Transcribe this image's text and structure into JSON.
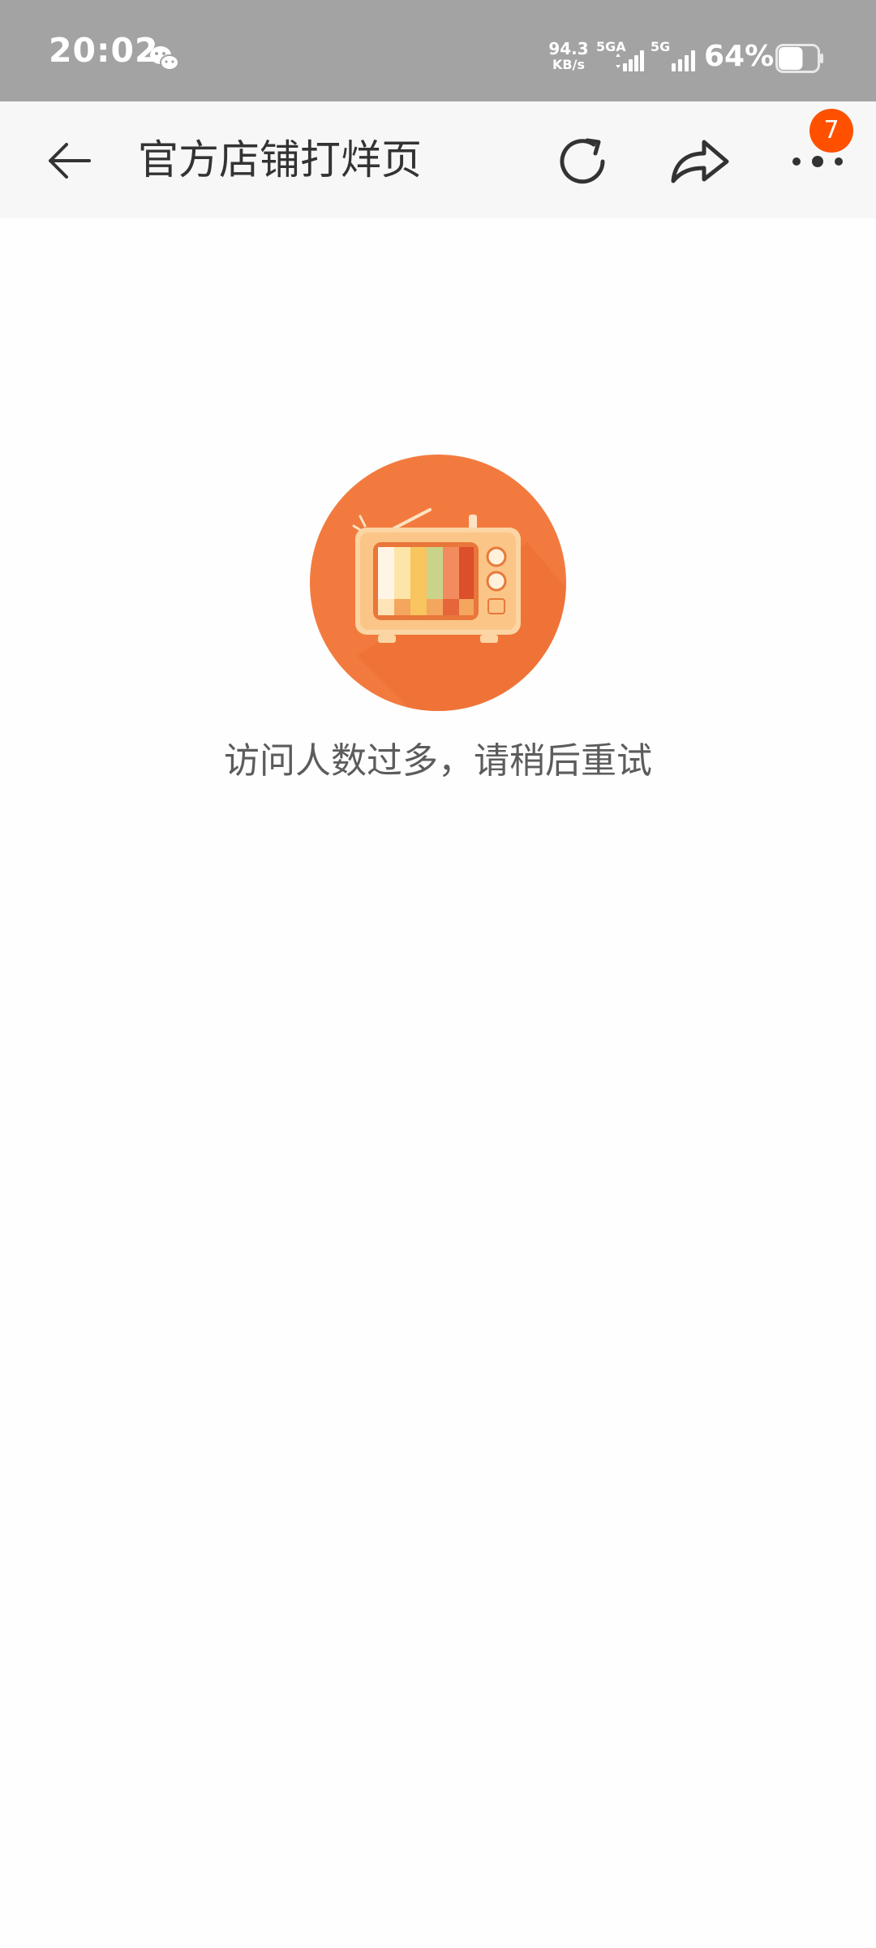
{
  "status_bar": {
    "time": "20:02",
    "net_speed_value": "94.3",
    "net_speed_unit": "KB/s",
    "sim1_label": "5GA",
    "sim2_label": "5G",
    "battery_percent": "64%",
    "battery_level": 0.64,
    "notification_icon": "wechat-icon"
  },
  "nav": {
    "title": "官方店铺打烊页",
    "back_icon": "arrow-left-icon",
    "refresh_icon": "refresh-icon",
    "share_icon": "share-icon",
    "more_icon": "more-dots-icon",
    "badge_count": "7",
    "badge_color": "#ff5000"
  },
  "content": {
    "illustration_icon": "retro-tv-icon",
    "message": "访问人数过多，请稍后重试",
    "accent_color": "#f37a3e"
  }
}
